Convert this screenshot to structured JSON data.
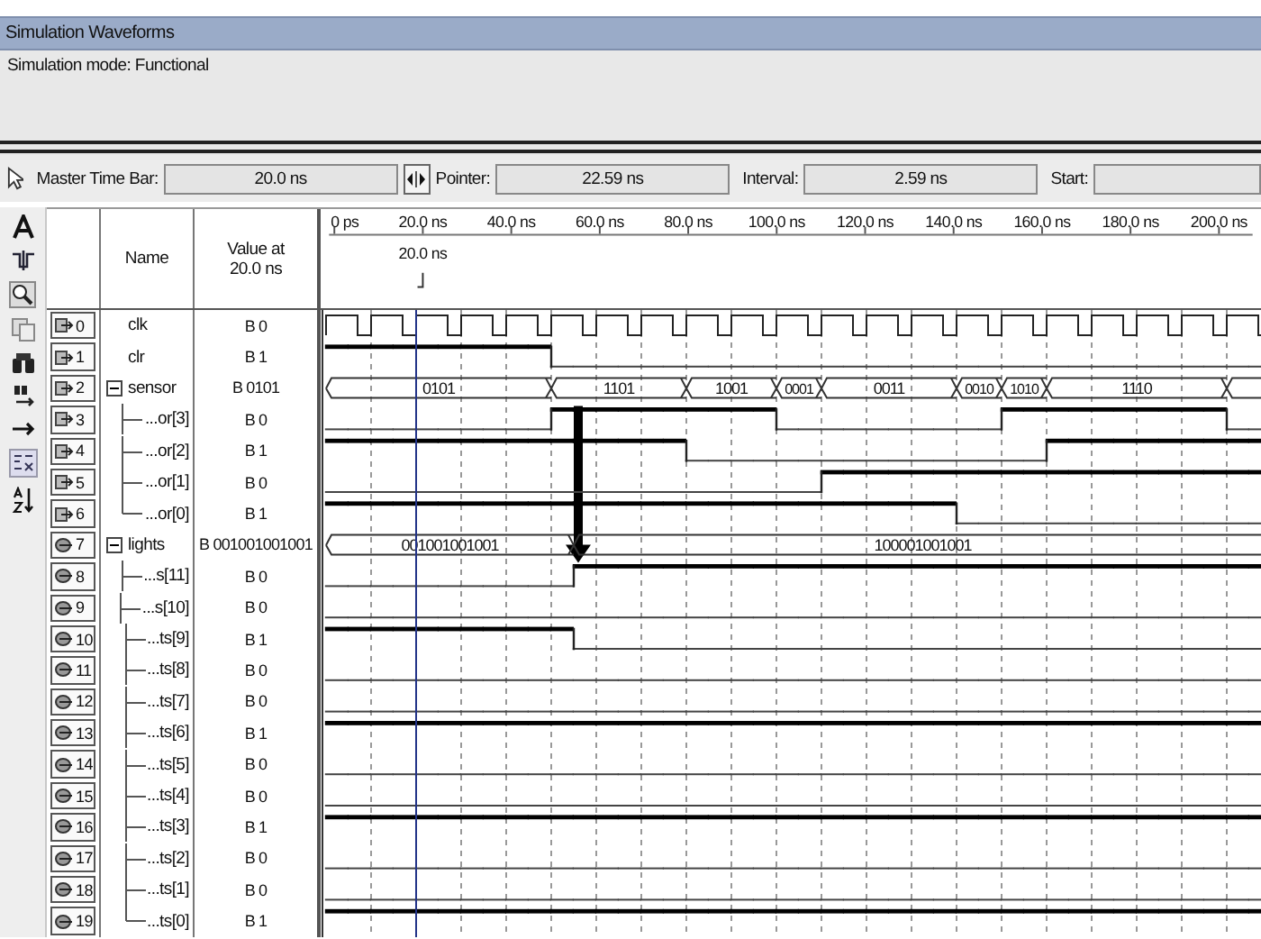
{
  "panel": {
    "title": "Simulation Waveforms",
    "mode": "Simulation mode: Functional"
  },
  "time_bar": {
    "master_label": "Master Time Bar:",
    "master_value": "20.0 ns",
    "pointer_label": "Pointer:",
    "pointer_value": "22.59 ns",
    "interval_label": "Interval:",
    "interval_value": "2.59 ns",
    "start_label": "Start:"
  },
  "columns": {
    "name": "Name",
    "value": "Value at 20.0 ns"
  },
  "timeline": {
    "ticks": [
      "0 ps",
      "20.0 ns",
      "40.0 ns",
      "60.0 ns",
      "80.0 ns",
      "100.0 ns",
      "120.0 ns",
      "140.0 ns",
      "160.0 ns",
      "180.0 ns",
      "200.0 ns"
    ],
    "cursor_label": "20.0 ns"
  },
  "signals": [
    {
      "index": "0",
      "kind": "input",
      "name": "clk",
      "value": "B 0",
      "wave": {
        "kind": "clock"
      }
    },
    {
      "index": "1",
      "kind": "input",
      "name": "clr",
      "value": "B 1",
      "wave": {
        "kind": "bit",
        "high": [
          true,
          true,
          true,
          true,
          true,
          true,
          true,
          true,
          true,
          true,
          false,
          false,
          false,
          false,
          false,
          false,
          false,
          false,
          false,
          false,
          false,
          false,
          false,
          false,
          false,
          false,
          false,
          false,
          false,
          false,
          false,
          false,
          false,
          false,
          false,
          false,
          false,
          false,
          false,
          false,
          false,
          false
        ]
      }
    },
    {
      "index": "2",
      "kind": "input",
      "name": "sensor",
      "value": "B 0101",
      "expanded": true,
      "wave": {
        "kind": "bus",
        "labels": [
          "0101",
          "1101",
          "1001",
          "0001",
          "0011",
          "0010",
          "1010",
          "1110"
        ],
        "edges": [
          true,
          false,
          false,
          false,
          false,
          false,
          false,
          false,
          false,
          false,
          true,
          false,
          false,
          false,
          false,
          false,
          true,
          false,
          false,
          false,
          true,
          false,
          true,
          false,
          false,
          false,
          false,
          false,
          true,
          false,
          true,
          false,
          true,
          false,
          false,
          false,
          false,
          false,
          false,
          false,
          true,
          false
        ]
      },
      "children": [
        {
          "index": "3",
          "kind": "input",
          "name": "...or[3]",
          "value": "B 0",
          "wave": {
            "kind": "bit",
            "high": [
              false,
              false,
              false,
              false,
              false,
              false,
              false,
              false,
              false,
              false,
              true,
              true,
              true,
              true,
              true,
              true,
              true,
              true,
              true,
              true,
              false,
              false,
              false,
              false,
              false,
              false,
              false,
              false,
              false,
              false,
              true,
              true,
              true,
              true,
              true,
              true,
              true,
              true,
              true,
              true,
              false,
              false
            ]
          }
        },
        {
          "index": "4",
          "kind": "input",
          "name": "...or[2]",
          "value": "B 1",
          "wave": {
            "kind": "bit",
            "high": [
              true,
              true,
              true,
              true,
              true,
              true,
              true,
              true,
              true,
              true,
              true,
              true,
              true,
              true,
              true,
              true,
              false,
              false,
              false,
              false,
              false,
              false,
              false,
              false,
              false,
              false,
              false,
              false,
              false,
              false,
              false,
              false,
              true,
              true,
              true,
              true,
              true,
              true,
              true,
              true,
              true,
              true
            ]
          }
        },
        {
          "index": "5",
          "kind": "input",
          "name": "...or[1]",
          "value": "B 0",
          "wave": {
            "kind": "bit",
            "high": [
              false,
              false,
              false,
              false,
              false,
              false,
              false,
              false,
              false,
              false,
              false,
              false,
              false,
              false,
              false,
              false,
              false,
              false,
              false,
              false,
              false,
              false,
              true,
              true,
              true,
              true,
              true,
              true,
              true,
              true,
              true,
              true,
              true,
              true,
              true,
              true,
              true,
              true,
              true,
              true,
              true,
              true
            ]
          }
        },
        {
          "index": "6",
          "kind": "input",
          "name": "...or[0]",
          "value": "B 1",
          "wave": {
            "kind": "bit",
            "high": [
              true,
              true,
              true,
              true,
              true,
              true,
              true,
              true,
              true,
              true,
              true,
              true,
              true,
              true,
              true,
              true,
              true,
              true,
              true,
              true,
              true,
              true,
              true,
              true,
              true,
              true,
              true,
              true,
              false,
              false,
              false,
              false,
              false,
              false,
              false,
              false,
              false,
              false,
              false,
              false,
              false,
              false
            ]
          }
        }
      ]
    },
    {
      "index": "7",
      "kind": "output",
      "name": "lights",
      "value": "B 001001001001",
      "expanded": true,
      "wave": {
        "kind": "bus",
        "labels": [
          "001001001001",
          "100001001001"
        ],
        "edges": [
          true,
          false,
          false,
          false,
          false,
          false,
          false,
          false,
          false,
          false,
          false,
          true,
          false,
          false,
          false,
          false,
          false,
          false,
          false,
          false,
          false,
          false,
          false,
          false,
          false,
          false,
          false,
          false,
          false,
          false,
          false,
          false,
          false,
          false,
          false,
          false,
          false,
          false,
          false,
          false,
          false,
          false
        ]
      },
      "children": [
        {
          "index": "8",
          "kind": "output",
          "name": "...s[11]",
          "value": "B 0",
          "wave": {
            "kind": "bit",
            "high": [
              false,
              false,
              false,
              false,
              false,
              false,
              false,
              false,
              false,
              false,
              false,
              true,
              true,
              true,
              true,
              true,
              true,
              true,
              true,
              true,
              true,
              true,
              true,
              true,
              true,
              true,
              true,
              true,
              true,
              true,
              true,
              true,
              true,
              true,
              true,
              true,
              true,
              true,
              true,
              true,
              true,
              true
            ]
          }
        },
        {
          "index": "9",
          "kind": "output",
          "name": "...s[10]",
          "value": "B 0",
          "wave": {
            "kind": "bit",
            "high": [
              false,
              false,
              false,
              false,
              false,
              false,
              false,
              false,
              false,
              false,
              false,
              false,
              false,
              false,
              false,
              false,
              false,
              false,
              false,
              false,
              false,
              false,
              false,
              false,
              false,
              false,
              false,
              false,
              false,
              false,
              false,
              false,
              false,
              false,
              false,
              false,
              false,
              false,
              false,
              false,
              false,
              false
            ]
          }
        },
        {
          "index": "10",
          "kind": "output",
          "name": "...ts[9]",
          "value": "B 1",
          "wave": {
            "kind": "bit",
            "high": [
              true,
              true,
              true,
              true,
              true,
              true,
              true,
              true,
              true,
              true,
              true,
              false,
              false,
              false,
              false,
              false,
              false,
              false,
              false,
              false,
              false,
              false,
              false,
              false,
              false,
              false,
              false,
              false,
              false,
              false,
              false,
              false,
              false,
              false,
              false,
              false,
              false,
              false,
              false,
              false,
              false,
              false
            ]
          }
        },
        {
          "index": "11",
          "kind": "output",
          "name": "...ts[8]",
          "value": "B 0",
          "wave": {
            "kind": "bit",
            "high": [
              false,
              false,
              false,
              false,
              false,
              false,
              false,
              false,
              false,
              false,
              false,
              false,
              false,
              false,
              false,
              false,
              false,
              false,
              false,
              false,
              false,
              false,
              false,
              false,
              false,
              false,
              false,
              false,
              false,
              false,
              false,
              false,
              false,
              false,
              false,
              false,
              false,
              false,
              false,
              false,
              false,
              false
            ]
          }
        },
        {
          "index": "12",
          "kind": "output",
          "name": "...ts[7]",
          "value": "B 0",
          "wave": {
            "kind": "bit",
            "high": [
              false,
              false,
              false,
              false,
              false,
              false,
              false,
              false,
              false,
              false,
              false,
              false,
              false,
              false,
              false,
              false,
              false,
              false,
              false,
              false,
              false,
              false,
              false,
              false,
              false,
              false,
              false,
              false,
              false,
              false,
              false,
              false,
              false,
              false,
              false,
              false,
              false,
              false,
              false,
              false,
              false,
              false
            ]
          }
        },
        {
          "index": "13",
          "kind": "output",
          "name": "...ts[6]",
          "value": "B 1",
          "wave": {
            "kind": "bit",
            "high": [
              true,
              true,
              true,
              true,
              true,
              true,
              true,
              true,
              true,
              true,
              true,
              true,
              true,
              true,
              true,
              true,
              true,
              true,
              true,
              true,
              true,
              true,
              true,
              true,
              true,
              true,
              true,
              true,
              true,
              true,
              true,
              true,
              true,
              true,
              true,
              true,
              true,
              true,
              true,
              true,
              true,
              true
            ]
          }
        },
        {
          "index": "14",
          "kind": "output",
          "name": "...ts[5]",
          "value": "B 0",
          "wave": {
            "kind": "bit",
            "high": [
              false,
              false,
              false,
              false,
              false,
              false,
              false,
              false,
              false,
              false,
              false,
              false,
              false,
              false,
              false,
              false,
              false,
              false,
              false,
              false,
              false,
              false,
              false,
              false,
              false,
              false,
              false,
              false,
              false,
              false,
              false,
              false,
              false,
              false,
              false,
              false,
              false,
              false,
              false,
              false,
              false,
              false
            ]
          }
        },
        {
          "index": "15",
          "kind": "output",
          "name": "...ts[4]",
          "value": "B 0",
          "wave": {
            "kind": "bit",
            "high": [
              false,
              false,
              false,
              false,
              false,
              false,
              false,
              false,
              false,
              false,
              false,
              false,
              false,
              false,
              false,
              false,
              false,
              false,
              false,
              false,
              false,
              false,
              false,
              false,
              false,
              false,
              false,
              false,
              false,
              false,
              false,
              false,
              false,
              false,
              false,
              false,
              false,
              false,
              false,
              false,
              false,
              false
            ]
          }
        },
        {
          "index": "16",
          "kind": "output",
          "name": "...ts[3]",
          "value": "B 1",
          "wave": {
            "kind": "bit",
            "high": [
              true,
              true,
              true,
              true,
              true,
              true,
              true,
              true,
              true,
              true,
              true,
              true,
              true,
              true,
              true,
              true,
              true,
              true,
              true,
              true,
              true,
              true,
              true,
              true,
              true,
              true,
              true,
              true,
              true,
              true,
              true,
              true,
              true,
              true,
              true,
              true,
              true,
              true,
              true,
              true,
              true,
              true
            ]
          }
        },
        {
          "index": "17",
          "kind": "output",
          "name": "...ts[2]",
          "value": "B 0",
          "wave": {
            "kind": "bit",
            "high": [
              false,
              false,
              false,
              false,
              false,
              false,
              false,
              false,
              false,
              false,
              false,
              false,
              false,
              false,
              false,
              false,
              false,
              false,
              false,
              false,
              false,
              false,
              false,
              false,
              false,
              false,
              false,
              false,
              false,
              false,
              false,
              false,
              false,
              false,
              false,
              false,
              false,
              false,
              false,
              false,
              false,
              false
            ]
          }
        },
        {
          "index": "18",
          "kind": "output",
          "name": "...ts[1]",
          "value": "B 0",
          "wave": {
            "kind": "bit",
            "high": [
              false,
              false,
              false,
              false,
              false,
              false,
              false,
              false,
              false,
              false,
              false,
              false,
              false,
              false,
              false,
              false,
              false,
              false,
              false,
              false,
              false,
              false,
              false,
              false,
              false,
              false,
              false,
              false,
              false,
              false,
              false,
              false,
              false,
              false,
              false,
              false,
              false,
              false,
              false,
              false,
              false,
              false
            ]
          }
        },
        {
          "index": "19",
          "kind": "output",
          "name": "...ts[0]",
          "value": "B 1",
          "wave": {
            "kind": "bit",
            "high": [
              true,
              true,
              true,
              true,
              true,
              true,
              true,
              true,
              true,
              true,
              true,
              true,
              true,
              true,
              true,
              true,
              true,
              true,
              true,
              true,
              true,
              true,
              true,
              true,
              true,
              true,
              true,
              true,
              true,
              true,
              true,
              true,
              true,
              true,
              true,
              true,
              true,
              true,
              true,
              true,
              true,
              true
            ]
          }
        }
      ]
    }
  ]
}
